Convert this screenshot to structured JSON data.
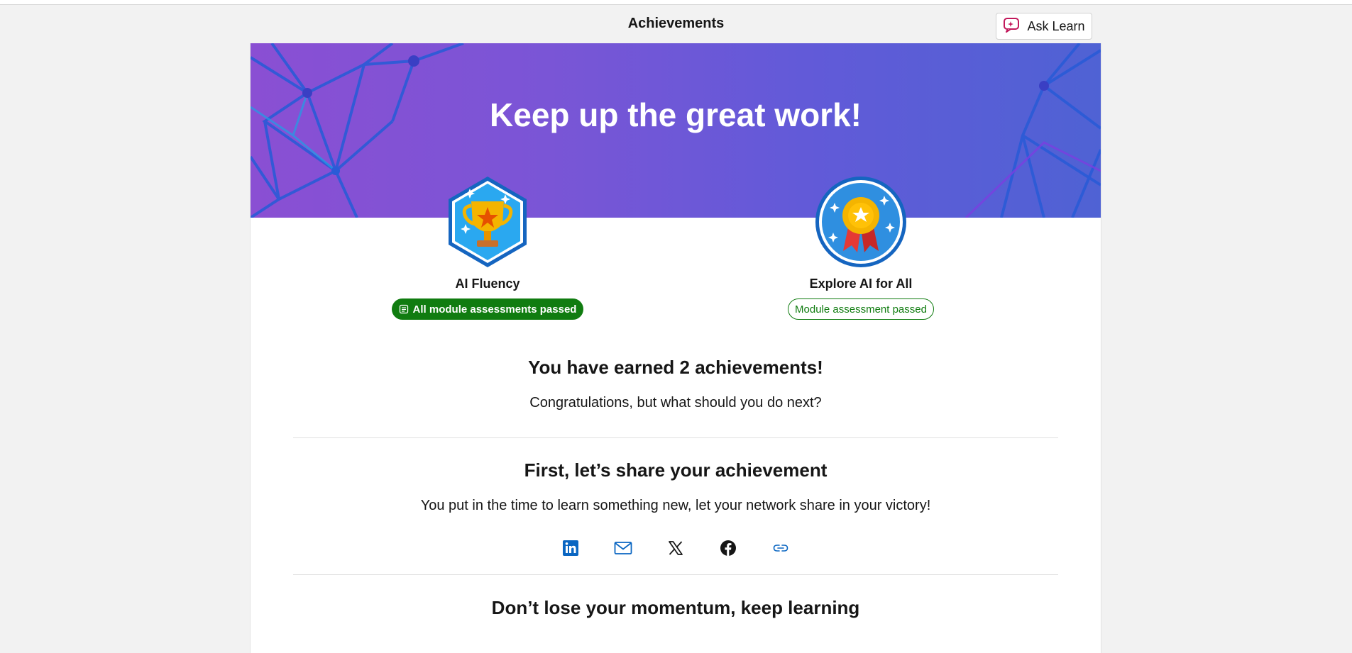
{
  "header": {
    "title": "Achievements",
    "ask_learn_label": "Ask Learn"
  },
  "banner": {
    "title": "Keep up the great work!"
  },
  "badges": [
    {
      "name": "AI Fluency",
      "status": "All module assessments passed",
      "icon": "trophy-icon"
    },
    {
      "name": "Explore AI for All",
      "status": "Module assessment passed",
      "icon": "medal-icon"
    }
  ],
  "earned": {
    "title": "You have earned 2 achievements!",
    "subtitle": "Congratulations, but what should you do next?"
  },
  "share": {
    "title": "First, let’s share your achievement",
    "subtitle": "You put in the time to learn something new, let your network share in your victory!",
    "icons": [
      "linkedin-icon",
      "email-icon",
      "x-icon",
      "facebook-icon",
      "link-icon"
    ]
  },
  "momentum": {
    "title": "Don’t lose your momentum, keep learning"
  },
  "colors": {
    "accent_green": "#107c10",
    "banner_purple": "#8a4fd3",
    "banner_blue": "#4f62d4",
    "linkedin_blue": "#0a66c2"
  }
}
